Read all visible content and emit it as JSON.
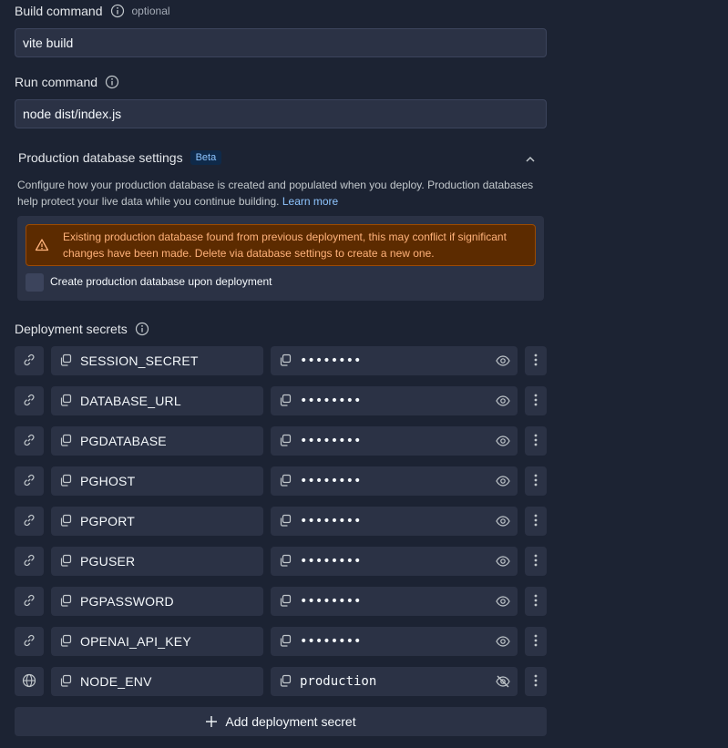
{
  "build_command": {
    "label": "Build command",
    "optional": "optional",
    "value": "vite build"
  },
  "run_command": {
    "label": "Run command",
    "value": "node dist/index.js"
  },
  "production_db": {
    "title": "Production database settings",
    "badge": "Beta",
    "description": "Configure how your production database is created and populated when you deploy. Production databases help protect your live data while you continue building.",
    "learn_more": "Learn more",
    "warning": "Existing production database found from previous deployment, this may conflict if significant changes have been made. Delete via database settings to create a new one.",
    "checkbox_label": "Create production database upon deployment"
  },
  "secrets": {
    "title": "Deployment secrets",
    "items": [
      {
        "key": "SESSION_SECRET",
        "value": "••••••••",
        "type": "link"
      },
      {
        "key": "DATABASE_URL",
        "value": "••••••••",
        "type": "link"
      },
      {
        "key": "PGDATABASE",
        "value": "••••••••",
        "type": "link"
      },
      {
        "key": "PGHOST",
        "value": "••••••••",
        "type": "link"
      },
      {
        "key": "PGPORT",
        "value": "••••••••",
        "type": "link"
      },
      {
        "key": "PGUSER",
        "value": "••••••••",
        "type": "link"
      },
      {
        "key": "PGPASSWORD",
        "value": "••••••••",
        "type": "link"
      },
      {
        "key": "OPENAI_API_KEY",
        "value": "••••••••",
        "type": "link"
      },
      {
        "key": "NODE_ENV",
        "value": "production",
        "type": "globe"
      }
    ],
    "add_label": "Add deployment secret"
  },
  "colors": {
    "background": "#1c2333",
    "field": "#2b3245",
    "warning_bg": "#5c2b00",
    "warning_text": "#ffb27a",
    "link": "#8ec5ff"
  }
}
